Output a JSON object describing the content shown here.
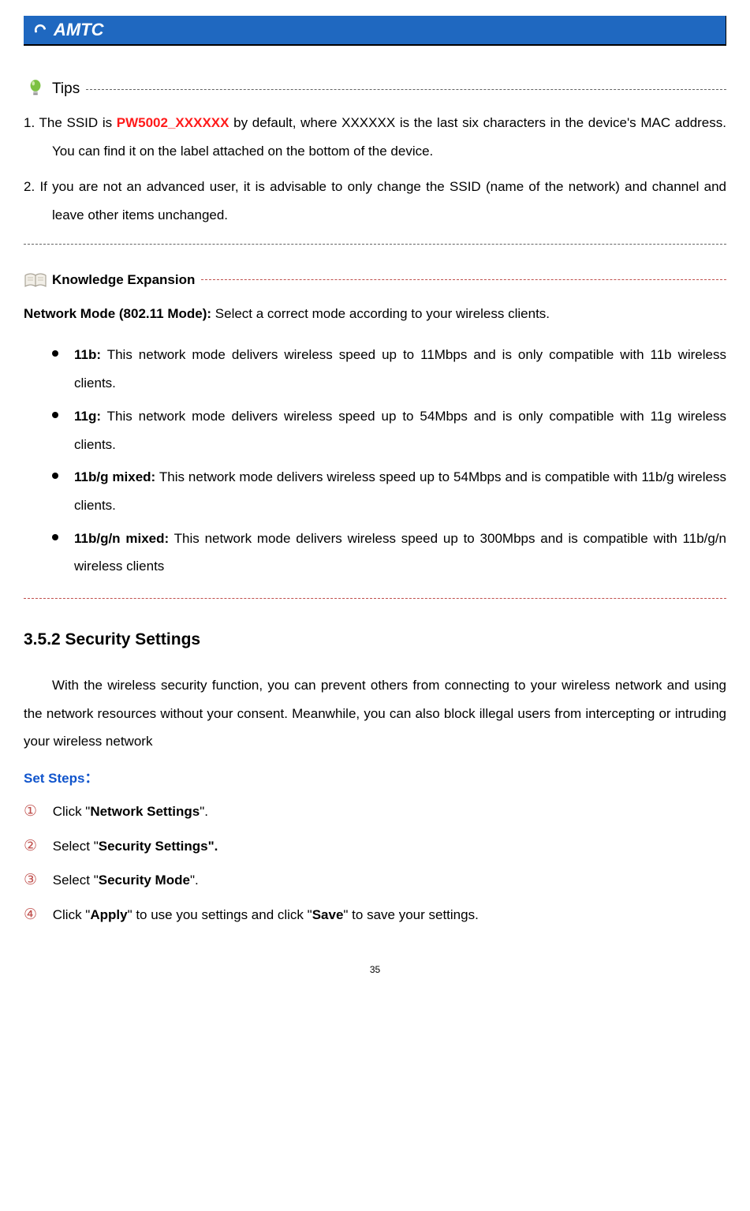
{
  "logo_text": "AMTC",
  "tips": {
    "label": "Tips",
    "items": [
      {
        "num": "1.",
        "pre": " The SSID is ",
        "highlight": "PW5002_XXXXXX",
        "post": " by default, where XXXXXX is the last six characters in the device's MAC address. You can find it on the label attached on the bottom of the device."
      },
      {
        "num": "2.",
        "text": " If you are not an advanced user, it is advisable to only change the SSID (name of the network) and channel and leave other items unchanged."
      }
    ]
  },
  "knowledge": {
    "label": "Knowledge Expansion",
    "intro_strong": "Network Mode (802.11 Mode):",
    "intro_rest": " Select a correct mode according to your wireless clients.",
    "bullets": [
      {
        "strong": "11b:",
        "rest": " This network mode delivers wireless speed up to 11Mbps and is only compatible with 11b wireless clients."
      },
      {
        "strong": "11g:",
        "rest": " This network mode delivers wireless speed up to 54Mbps and is only compatible with 11g wireless clients."
      },
      {
        "strong": "11b/g mixed:",
        "rest": " This network mode delivers wireless speed up to 54Mbps and is compatible with 11b/g wireless clients."
      },
      {
        "strong": "11b/g/n mixed:",
        "rest": " This network mode delivers wireless speed up to 300Mbps and is compatible with 11b/g/n wireless clients"
      }
    ]
  },
  "section": {
    "heading": "3.5.2 Security Settings",
    "intro": "With the wireless security function, you can prevent others from connecting to your wireless network and using the network resources without your consent. Meanwhile, you can also block illegal users from intercepting or intruding your wireless network",
    "set_steps_label": "Set Steps：",
    "steps": [
      {
        "n": "①",
        "pre": "Click \"",
        "b": "Network Settings",
        "post": "\"."
      },
      {
        "n": "②",
        "pre": "Select \"",
        "b": "Security Settings",
        "post": "\"."
      },
      {
        "n": "③",
        "pre": "Select \"",
        "b": "Security Mode",
        "post": "\"."
      },
      {
        "n": "④",
        "pre": "Click \"",
        "b": "Apply",
        "mid": "\" to use you settings and click \"",
        "b2": "Save",
        "post": "\" to save your settings."
      }
    ]
  },
  "page_number": "35"
}
